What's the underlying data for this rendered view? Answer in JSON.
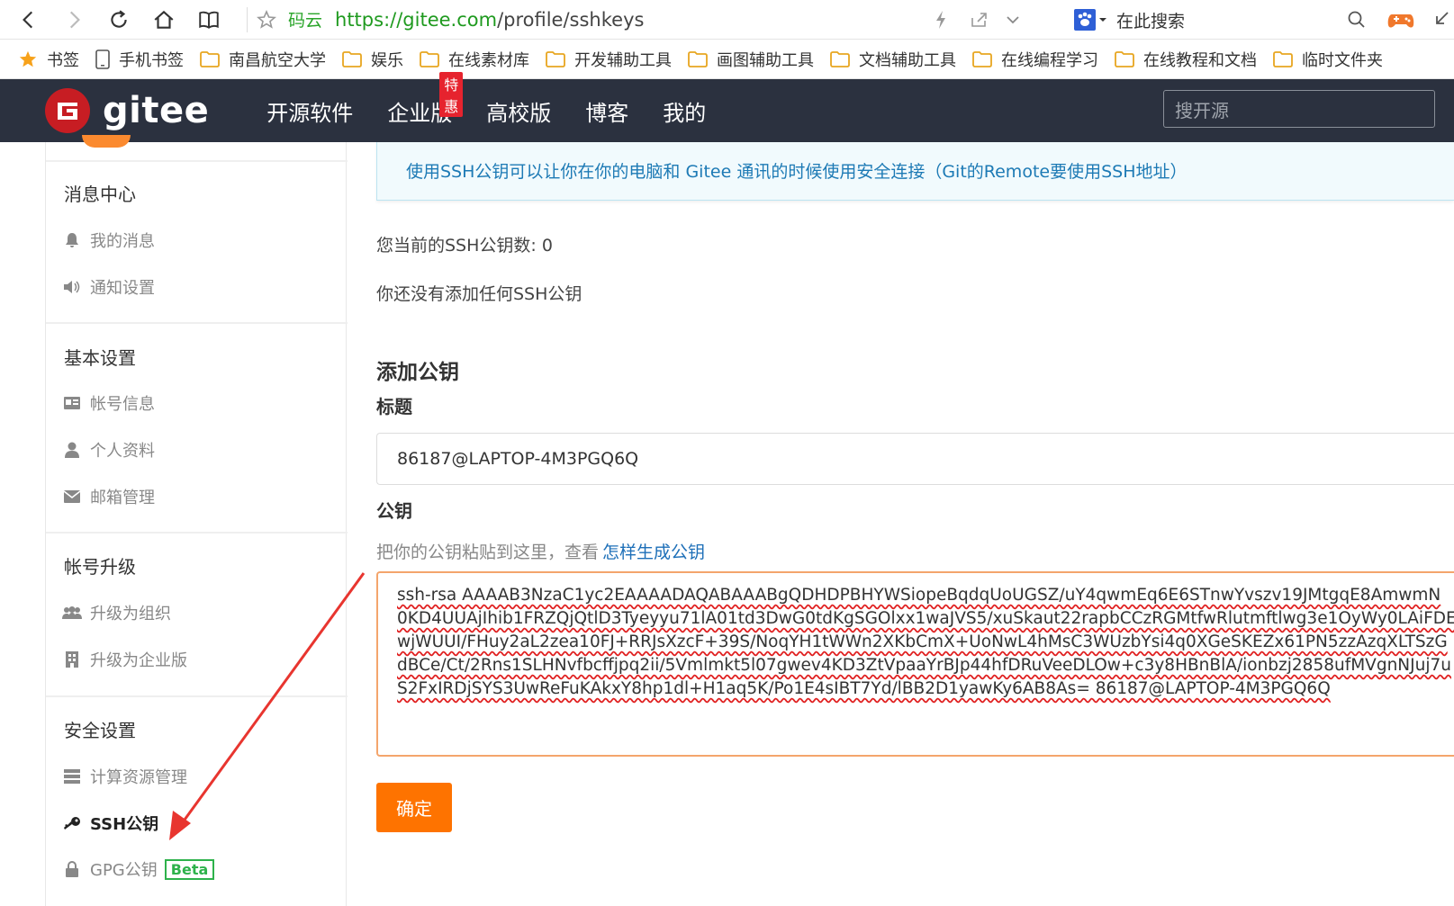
{
  "browser": {
    "site_name": "码云",
    "url_scheme": "https://",
    "url_host": "gitee.com",
    "url_path": "/profile/sshkeys",
    "search_placeholder": "在此搜索"
  },
  "bookmarks": [
    {
      "label": "书签",
      "icon": "star-icon"
    },
    {
      "label": "手机书签",
      "icon": "phone-icon"
    },
    {
      "label": "南昌航空大学",
      "icon": "folder-icon"
    },
    {
      "label": "娱乐",
      "icon": "folder-icon"
    },
    {
      "label": "在线素材库",
      "icon": "folder-icon"
    },
    {
      "label": "开发辅助工具",
      "icon": "folder-icon"
    },
    {
      "label": "画图辅助工具",
      "icon": "folder-icon"
    },
    {
      "label": "文档辅助工具",
      "icon": "folder-icon"
    },
    {
      "label": "在线编程学习",
      "icon": "folder-icon"
    },
    {
      "label": "在线教程和文档",
      "icon": "folder-icon"
    },
    {
      "label": "临时文件夹",
      "icon": "folder-icon"
    }
  ],
  "header": {
    "logo_text": "gitee",
    "nav": [
      "开源软件",
      "企业版",
      "高校版",
      "博客",
      "我的"
    ],
    "enterprise_badge": "特惠",
    "search_placeholder": "搜开源"
  },
  "sidebar": {
    "sections": [
      {
        "title": "消息中心",
        "items": [
          {
            "label": "我的消息",
            "icon": "bell-icon"
          },
          {
            "label": "通知设置",
            "icon": "speaker-icon"
          }
        ]
      },
      {
        "title": "基本设置",
        "items": [
          {
            "label": "帐号信息",
            "icon": "id-card-icon"
          },
          {
            "label": "个人资料",
            "icon": "user-icon"
          },
          {
            "label": "邮箱管理",
            "icon": "envelope-icon"
          }
        ]
      },
      {
        "title": "帐号升级",
        "items": [
          {
            "label": "升级为组织",
            "icon": "users-icon"
          },
          {
            "label": "升级为企业版",
            "icon": "building-icon"
          }
        ]
      },
      {
        "title": "安全设置",
        "items": [
          {
            "label": "计算资源管理",
            "icon": "server-icon"
          },
          {
            "label": "SSH公钥",
            "icon": "key-icon",
            "active": true
          },
          {
            "label": "GPG公钥",
            "icon": "lock-icon",
            "badge": "Beta"
          }
        ]
      }
    ]
  },
  "main": {
    "info": "使用SSH公钥可以让你在你的电脑和 Gitee 通讯的时候使用安全连接（Git的Remote要使用SSH地址）",
    "count_text": "您当前的SSH公钥数: 0",
    "empty_text": "你还没有添加任何SSH公钥",
    "add_heading": "添加公钥",
    "title_label": "标题",
    "title_value": "86187@LAPTOP-4M3PGQ6Q",
    "key_label": "公钥",
    "key_hint": "把你的公钥粘贴到这里，查看",
    "key_hint_link": "怎样生成公钥",
    "key_lines": [
      "ssh-rsa AAAAB3NzaC1yc2EAAAADAQABAAABgQDHDPBHYWSiopeBqdqUoUGSZ/uY4qwmEq6E6STnwYvszv19JMtgqE8AmwmN",
      "0KD4UUAjIhib1FRZQjQtlD3Tyeyyu71lA01td3DwG0tdKgSGOlxx1waJVS5/xuSkaut22rapbCCzRGMtfwRlutmftlwg3e1OyWy0LAiFDE",
      "wjWUUI/FHuy2aL2zea10FJ+RRJsXzcF+39S/NoqYH1tWWn2XKbCmX+UoNwL4hMsC3WUzbYsi4q0XGeSKEZx61PN5zzAzqXLTSzG",
      "dBCe/Ct/2Rns1SLHNvfbcffjpq2ii/5Vmlmkt5l07gwev4KD3ZtVpaaYrBJp44hfDRuVeeDLOw+c3y8HBnBlA/ionbzj2858ufMVgnNJuj7u",
      "S2FxIRDjSYS3UwReFuKAkxY8hp1dl+H1aq5K/Po1E4sIBT7Yd/lBB2D1yawKy6AB8As= 86187@LAPTOP-4M3PGQ6Q"
    ],
    "confirm_label": "确定"
  },
  "colors": {
    "header_bg": "#2b313f",
    "accent": "#fe7300",
    "link": "#1d6fb8",
    "arrow": "#e8352f"
  }
}
